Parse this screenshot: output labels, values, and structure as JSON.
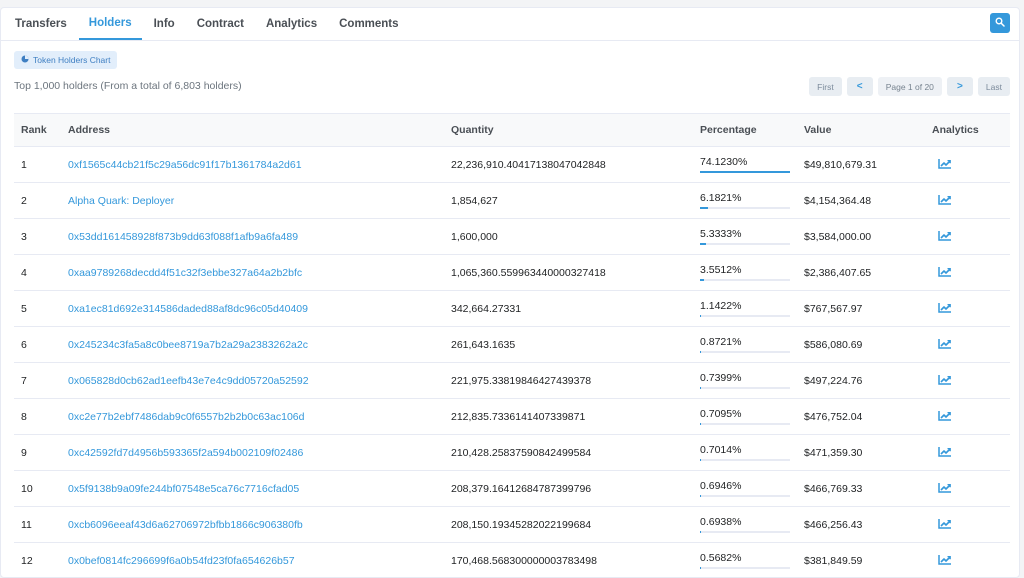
{
  "tabs": [
    {
      "label": "Transfers",
      "active": false
    },
    {
      "label": "Holders",
      "active": true
    },
    {
      "label": "Info",
      "active": false
    },
    {
      "label": "Contract",
      "active": false
    },
    {
      "label": "Analytics",
      "active": false
    },
    {
      "label": "Comments",
      "active": false
    }
  ],
  "chart_button": {
    "label": "Token Holders Chart"
  },
  "summary": "Top 1,000 holders (From a total of 6,803 holders)",
  "pager": {
    "first": "First",
    "prev": "<",
    "info": "Page 1 of 20",
    "next": ">",
    "last": "Last"
  },
  "table": {
    "headers": {
      "rank": "Rank",
      "address": "Address",
      "quantity": "Quantity",
      "percentage": "Percentage",
      "value": "Value",
      "analytics": "Analytics"
    },
    "rows": [
      {
        "rank": "1",
        "address": "0xf1565c44cb21f5c29a56dc91f17b1361784a2d61",
        "quantity": "22,236,910.40417138047042848",
        "percentage": "74.1230%",
        "pct": 74.123,
        "value": "$49,810,679.31"
      },
      {
        "rank": "2",
        "address": "Alpha Quark: Deployer",
        "quantity": "1,854,627",
        "percentage": "6.1821%",
        "pct": 6.1821,
        "value": "$4,154,364.48"
      },
      {
        "rank": "3",
        "address": "0x53dd161458928f873b9dd63f088f1afb9a6fa489",
        "quantity": "1,600,000",
        "percentage": "5.3333%",
        "pct": 5.3333,
        "value": "$3,584,000.00"
      },
      {
        "rank": "4",
        "address": "0xaa9789268decdd4f51c32f3ebbe327a64a2b2bfc",
        "quantity": "1,065,360.559963440000327418",
        "percentage": "3.5512%",
        "pct": 3.5512,
        "value": "$2,386,407.65"
      },
      {
        "rank": "5",
        "address": "0xa1ec81d692e314586daded88af8dc96c05d40409",
        "quantity": "342,664.27331",
        "percentage": "1.1422%",
        "pct": 1.1422,
        "value": "$767,567.97"
      },
      {
        "rank": "6",
        "address": "0x245234c3fa5a8c0bee8719a7b2a29a2383262a2c",
        "quantity": "261,643.1635",
        "percentage": "0.8721%",
        "pct": 0.8721,
        "value": "$586,080.69"
      },
      {
        "rank": "7",
        "address": "0x065828d0cb62ad1eefb43e7e4c9dd05720a52592",
        "quantity": "221,975.33819846427439378",
        "percentage": "0.7399%",
        "pct": 0.7399,
        "value": "$497,224.76"
      },
      {
        "rank": "8",
        "address": "0xc2e77b2ebf7486dab9c0f6557b2b2b0c63ac106d",
        "quantity": "212,835.7336141407339871",
        "percentage": "0.7095%",
        "pct": 0.7095,
        "value": "$476,752.04"
      },
      {
        "rank": "9",
        "address": "0xc42592fd7d4956b593365f2a594b002109f02486",
        "quantity": "210,428.25837590842499584",
        "percentage": "0.7014%",
        "pct": 0.7014,
        "value": "$471,359.30"
      },
      {
        "rank": "10",
        "address": "0x5f9138b9a09fe244bf07548e5ca76c7716cfad05",
        "quantity": "208,379.16412684787399796",
        "percentage": "0.6946%",
        "pct": 0.6946,
        "value": "$466,769.33"
      },
      {
        "rank": "11",
        "address": "0xcb6096eeaf43d6a62706972bfbb1866c906380fb",
        "quantity": "208,150.19345282022199684",
        "percentage": "0.6938%",
        "pct": 0.6938,
        "value": "$466,256.43"
      },
      {
        "rank": "12",
        "address": "0x0bef0814fc296699f6a0b54fd23f0fa654626b57",
        "quantity": "170,468.568300000003783498",
        "percentage": "0.5682%",
        "pct": 0.5682,
        "value": "$381,849.59"
      }
    ]
  },
  "icons": {
    "search": "search-icon",
    "chart": "pie-chart-icon",
    "analytics": "line-chart-icon"
  },
  "colors": {
    "accent": "#3498db",
    "page_bg": "#f3f4f6",
    "header_bg": "#f8f9fa"
  }
}
